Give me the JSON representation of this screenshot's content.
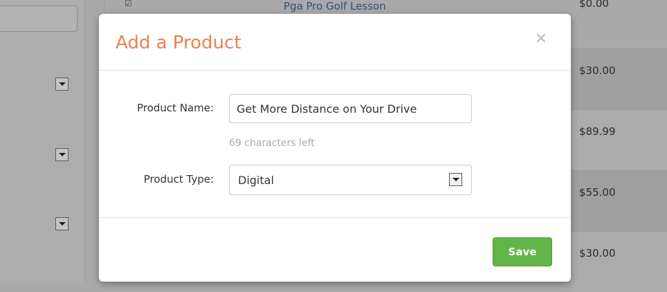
{
  "background": {
    "top_link_text": "Pga Pro Golf Lesson",
    "top_price": "$0.00",
    "prices": [
      "$30.00",
      "$89.99",
      "$55.00",
      "$30.00"
    ]
  },
  "modal": {
    "title": "Add a Product",
    "close_icon": "close-icon",
    "close_glyph": "×",
    "fields": {
      "product_name_label": "Product Name:",
      "product_name_value": "Get More Distance on Your Drive",
      "chars_left": "69 characters left",
      "product_type_label": "Product Type:",
      "product_type_value": "Digital"
    },
    "save_label": "Save"
  },
  "colors": {
    "title": "#e8824f",
    "save_button": "#62b547",
    "overlay": "#a9a9a9"
  }
}
